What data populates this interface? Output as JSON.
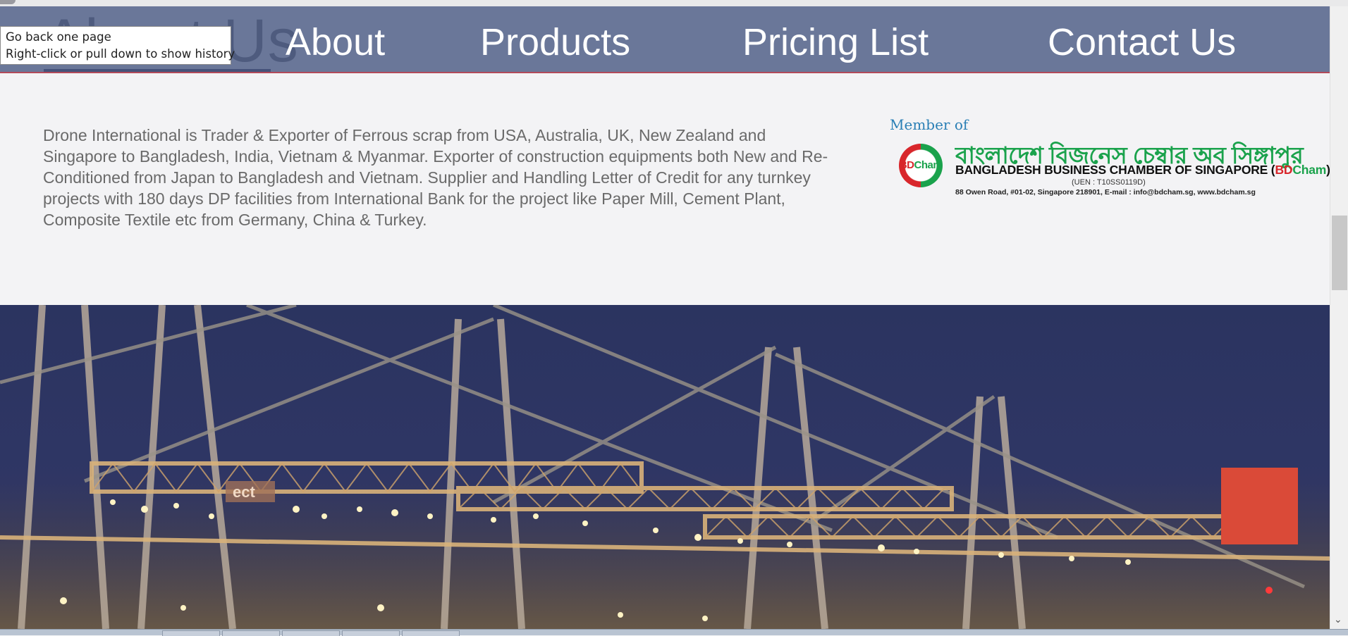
{
  "navbar": {
    "active_page_text": "About Us",
    "items": [
      {
        "label": "About"
      },
      {
        "label": "Products"
      },
      {
        "label": "Pricing List"
      },
      {
        "label": "Contact Us"
      }
    ],
    "bg_color": "#6a7799"
  },
  "tooltip": {
    "line1": "Go back one page",
    "line2": "Right-click or pull down to show history"
  },
  "intro": {
    "text": "Drone International is Trader & Exporter of Ferrous scrap from USA, Australia, UK, New Zealand and Singapore to Bangladesh, India, Vietnam & Myanmar. Exporter of construction equipments both New and Re-Conditioned from Japan to Bangladesh and Vietnam. Supplier and Handling Letter of Credit for any turnkey projects with 180 days DP facilities from International Bank for the project like Paper Mill, Cement Plant, Composite Textile etc from Germany, China & Turkey."
  },
  "membership": {
    "label": "Member of",
    "logo": {
      "circle_bd": "BD",
      "circle_cham": "Cham",
      "bangla_name": "বাংলাদেশ বিজনেস চেম্বার অব সিঙ্গাপুর",
      "name_prefix": "BANGLADESH BUSINESS CHAMBER OF SINGAPORE (",
      "name_bd": "BD",
      "name_cham": "Cham",
      "name_suffix": ")",
      "uen": "(UEN : T10SS0119D)",
      "address": "88 Owen Road, #01-02, Singapore 218901, E-mail : info@bdcham.sg, www.bdcham.sg"
    }
  },
  "hero": {
    "image": "container-port-cranes-at-night",
    "crane_sign": "ect"
  },
  "back_to_top": {
    "color": "#da4a38"
  },
  "scrollbar": {
    "down_arrow": "⌄"
  }
}
